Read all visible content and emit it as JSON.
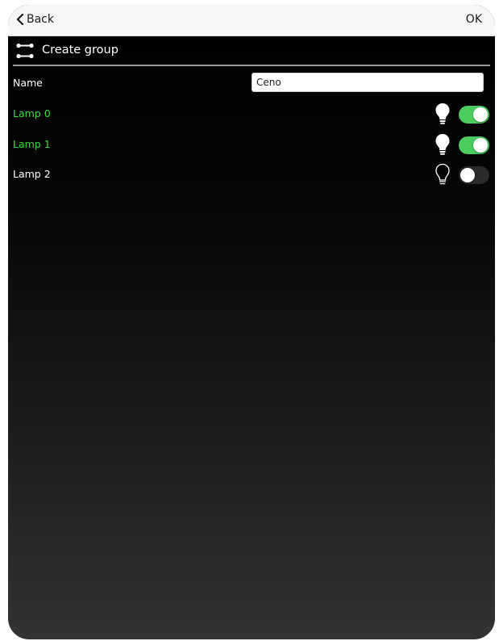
{
  "navbar": {
    "back_label": "Back",
    "ok_label": "OK"
  },
  "header": {
    "title": "Create group",
    "icon": "group-icon"
  },
  "name_field": {
    "label": "Name",
    "value": "Ceno"
  },
  "lamps": [
    {
      "label": "Lamp 0",
      "on": true,
      "color": "#3adc3a"
    },
    {
      "label": "Lamp 1",
      "on": true,
      "color": "#3adc3a"
    },
    {
      "label": "Lamp 2",
      "on": false,
      "color": "#ffffff"
    }
  ],
  "colors": {
    "toggle_on": "#4bcc5e",
    "active_label": "#3adc3a"
  }
}
